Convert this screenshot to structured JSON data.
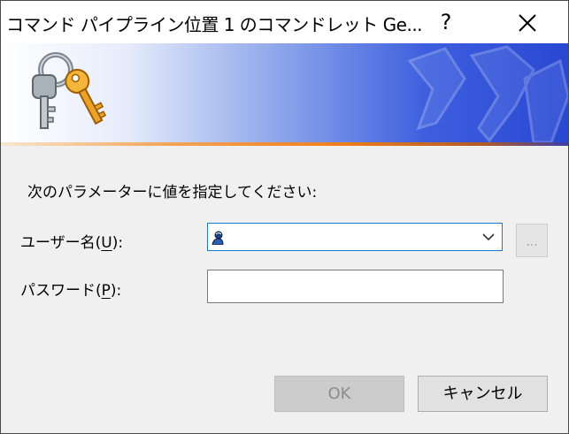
{
  "window": {
    "title": "コマンド パイプライン位置 1 のコマンドレット Ge...",
    "help_label": "?"
  },
  "colors": {
    "accent_border": "#1a78d4",
    "banner_blue": "#2848d2",
    "banner_orange": "#f07e1a",
    "disabled_text": "#8c8c8c"
  },
  "icons": {
    "banner": "keys-icon",
    "watermark": "brand-watermark-icon",
    "user": "user-icon",
    "dropdown": "chevron-down-icon",
    "close": "close-icon"
  },
  "form": {
    "prompt": "次のパラメーターに値を指定してください:",
    "username": {
      "label_prefix": "ユーザー名(",
      "accelerator": "U",
      "label_suffix": "):",
      "value": ""
    },
    "browse_label": "...",
    "password": {
      "label_prefix": "パスワード(",
      "accelerator": "P",
      "label_suffix": "):",
      "value": ""
    }
  },
  "buttons": {
    "ok": "OK",
    "cancel": "キャンセル"
  }
}
